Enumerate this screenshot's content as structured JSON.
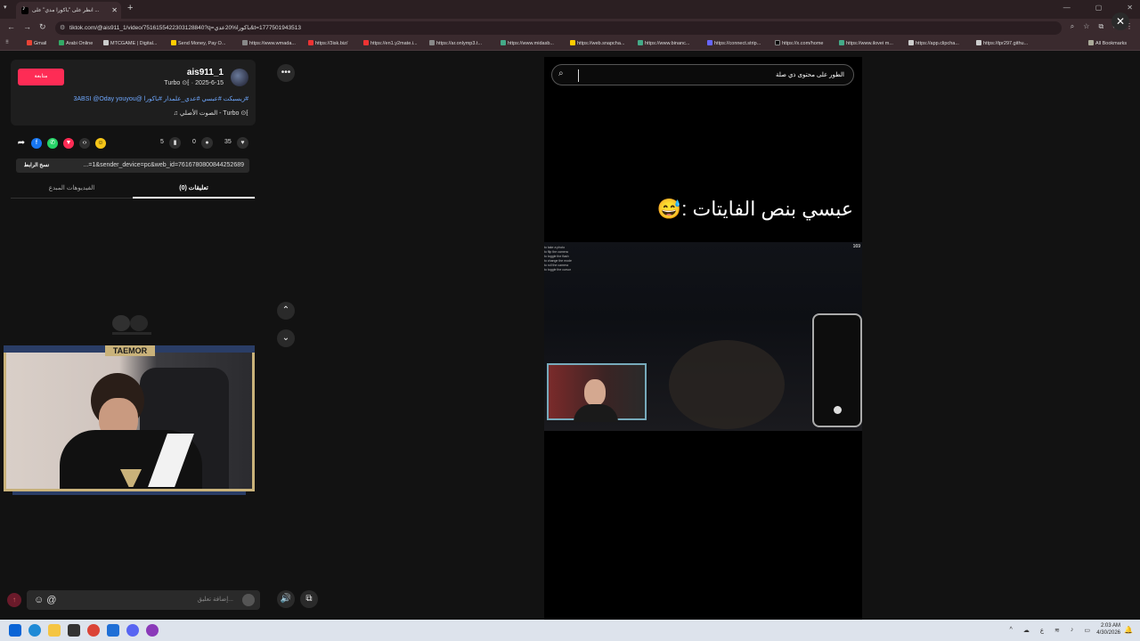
{
  "browser": {
    "tab_title": "انظر على \"باكورا مدي\" على ...",
    "url": "tiktok.com/@ais911_1/video/7516155422303128840?q=باكورا%20عدي&t=1777501943513",
    "bookmarks": [
      "Gmail",
      "Arabi Online",
      "MTCGAME | Digital...",
      "Send Money, Pay O...",
      "https://www.wmada...",
      "https://3isk.biz/",
      "https://en1.y2mate.i...",
      "https://ar.onlymp3.t...",
      "https://www.midasb...",
      "https://web.snapcha...",
      "https://www.binanc...",
      "https://connect.strip...",
      "https://x.com/home",
      "https://www.ilovei m...",
      "https://app.clipcha...",
      "https://tpr297.githu..."
    ],
    "all_bookmarks": "All Bookmarks"
  },
  "post": {
    "follow_label": "متابعة",
    "username": "ais911_1",
    "subline": "Turbo ⊙⁅ · 2025-6-15",
    "description": "#زيسبكت #عبسي #عدي_علمدار #باكورا @3ABSI @Oday youyou",
    "sound": "♫ الصوت الأصلي - Turbo ⊙⁅",
    "likes": "35",
    "comments": "0",
    "saves": "5",
    "copy_label": "نسخ الرابط",
    "link_text": "...=1&sender_device=pc&web_id=7616780800844252689",
    "tab_comments": "تعليقات (0)",
    "tab_creator_videos": "الفيديوهات المبدع",
    "comment_placeholder": "إضافة تعليق..."
  },
  "overlay": {
    "webcam_label": "TAEMOR"
  },
  "video": {
    "search_query": "الطور على محتوى ذي صلة",
    "caption": "عبسي بنص الفايتات :😅",
    "hud_lines": [
      "to take a photo",
      "to flip the camera",
      "to toggle the flash",
      "to change the mode",
      "to roll the camera",
      "to toggle the cursor"
    ],
    "hud_number": "169"
  },
  "taskbar": {
    "time": "2:03 AM",
    "date": "4/30/2026"
  },
  "colors": {
    "accent": "#fe2c55",
    "link": "#6fa8ff",
    "bg": "#121212"
  }
}
